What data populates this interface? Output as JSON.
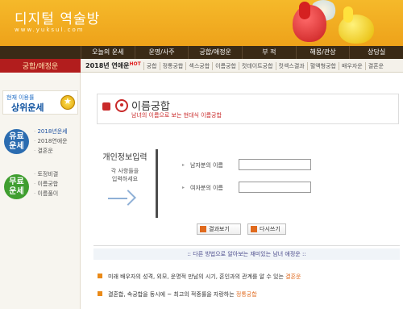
{
  "header": {
    "title": "디지털 역술방",
    "url": "www.yuksul.com"
  },
  "topnav": {
    "items": [
      "오늘의 운세",
      "운명/사주",
      "궁합/애정운",
      "부 적",
      "해몽/관상",
      "상담실"
    ]
  },
  "subnav": {
    "section": "궁합/애정운",
    "hot_badge": "HOT",
    "items": [
      "2018년 연애운",
      "궁합",
      "정통궁합",
      "섹스궁합",
      "이름궁합",
      "컷데이트궁합",
      "컷섹스결과",
      "혈액형궁합",
      "배우자운",
      "결혼운"
    ]
  },
  "left": {
    "rank_small": "현재 이용률",
    "rank_big": "상위운세",
    "paid_badge": "유료\n운세",
    "paid_items": [
      "2018년운세",
      "2018연애운",
      "결혼운"
    ],
    "free_badge": "무료\n운세",
    "free_items": [
      "토정비결",
      "이름궁합",
      "이름풀이"
    ]
  },
  "main": {
    "title": "이름궁합",
    "subtitle": "남녀의 이름으로 보는 현대식 이름궁합",
    "info_heading": "개인정보입력",
    "info_desc_1": "각 사항들을",
    "info_desc_2": "입력하세요",
    "male_label": "남자분의 이름",
    "male_value": "",
    "female_label": "여자분의 이름",
    "female_value": "",
    "btn_view": "결과보기",
    "btn_rewrite": "다시쓰기",
    "note_title": ":: 다른 방법으로 알아보는 재미있는 남녀 애정운 ::",
    "note1_text": "미래 배우자의 성격, 외모, 운명적 만남의 시기, 혼인과의 관계를 알 수 있는 ",
    "note1_link": "결혼운",
    "note2_text": "결혼합, 속궁합을 동시에 ~ 최고의 적중률을 자랑하는 ",
    "note2_link": "정통궁합"
  }
}
